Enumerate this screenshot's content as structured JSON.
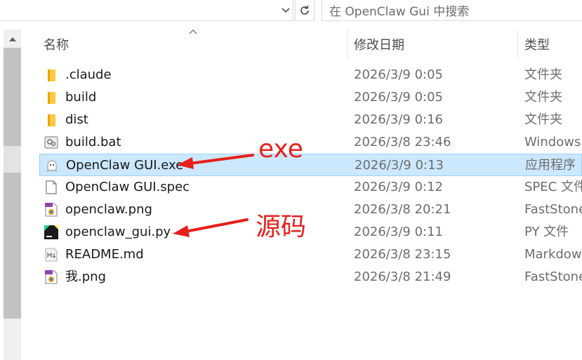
{
  "search": {
    "placeholder": "在 OpenClaw Gui 中搜索"
  },
  "columns": {
    "name": "名称",
    "date": "修改日期",
    "type": "类型"
  },
  "files": [
    {
      "name": ".claude",
      "date": "2026/3/9 0:05",
      "type": "文件夹",
      "icon": "folder-icon"
    },
    {
      "name": "build",
      "date": "2026/3/9 0:05",
      "type": "文件夹",
      "icon": "folder-icon"
    },
    {
      "name": "dist",
      "date": "2026/3/9 0:16",
      "type": "文件夹",
      "icon": "folder-icon"
    },
    {
      "name": "build.bat",
      "date": "2026/3/8 23:46",
      "type": "Windows",
      "icon": "batch-file-icon"
    },
    {
      "name": "OpenClaw GUI.exe",
      "date": "2026/3/9 0:13",
      "type": "应用程序",
      "icon": "app-ghost-icon",
      "selected": true
    },
    {
      "name": "OpenClaw GUI.spec",
      "date": "2026/3/9 0:12",
      "type": "SPEC 文件",
      "icon": "blank-file-icon"
    },
    {
      "name": "openclaw.png",
      "date": "2026/3/8 20:21",
      "type": "FastStone",
      "icon": "png-image-icon"
    },
    {
      "name": "openclaw_gui.py",
      "date": "2026/3/9 0:11",
      "type": "PY 文件",
      "icon": "pycharm-file-icon"
    },
    {
      "name": "README.md",
      "date": "2026/3/8 23:15",
      "type": "Markdow",
      "icon": "markdown-file-icon"
    },
    {
      "name": "我.png",
      "date": "2026/3/8 21:49",
      "type": "FastStone",
      "icon": "png-image-icon"
    }
  ],
  "annotations": {
    "exe_label": "exe",
    "source_label": "源码",
    "color": "#e8201b"
  },
  "colors": {
    "selection_bg": "#cce8ff",
    "selection_border": "#99d1ff",
    "folder": "#ffc83d"
  }
}
